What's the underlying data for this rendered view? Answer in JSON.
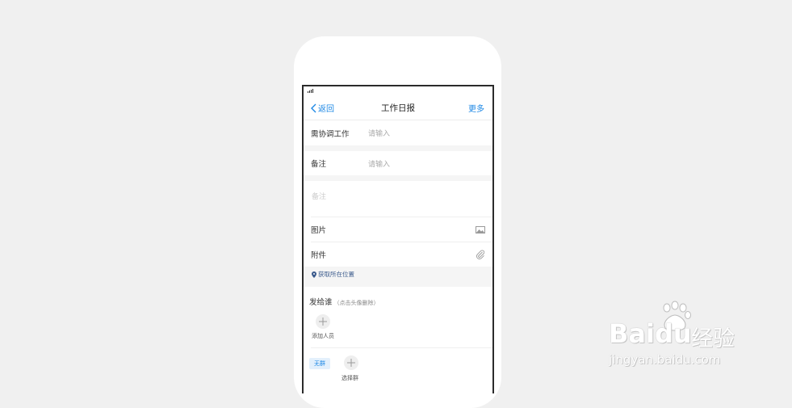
{
  "navbar": {
    "back_label": "返回",
    "title": "工作日报",
    "more_label": "更多"
  },
  "form": {
    "coordination": {
      "label": "需协调工作",
      "placeholder": "请输入"
    },
    "remarks": {
      "label": "备注",
      "placeholder": "请输入"
    },
    "notes_placeholder": "备注",
    "images": {
      "label": "图片",
      "icon": "image-icon"
    },
    "attachment": {
      "label": "附件",
      "icon": "paperclip-icon"
    },
    "location": {
      "label": "获取所在位置",
      "icon": "location-pin-icon"
    }
  },
  "send_to": {
    "title": "发给谁",
    "hint": "（点击头像删除）",
    "add_person_label": "添加人员",
    "group_tag": "无群",
    "select_group_label": "选择群"
  },
  "watermark": {
    "main": "Baidu",
    "cn": "经验",
    "sub": "jingyan.baidu.com"
  },
  "colors": {
    "accent": "#1e88e5",
    "location": "#3a5a8c"
  }
}
